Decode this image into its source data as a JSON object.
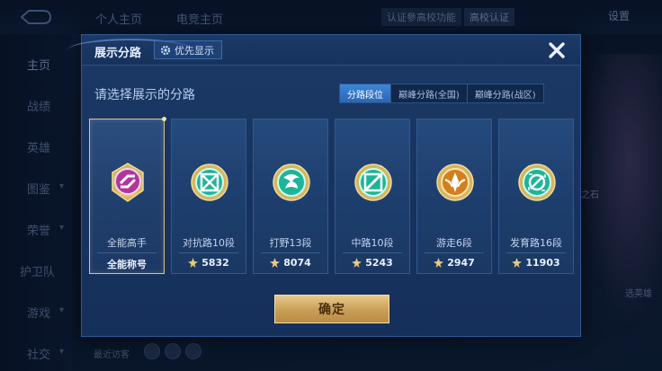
{
  "background": {
    "tabs": [
      "个人主页",
      "电竞主页"
    ],
    "badges": [
      "认证參高校功能",
      "高校认证"
    ],
    "settings_label": "设置",
    "sidebar": [
      "主页",
      "战绩",
      "英雄",
      "图鉴",
      "荣誉",
      "护卫队",
      "游戏",
      "社交"
    ],
    "hero_text": "之石",
    "right_button": "选英雄",
    "recent_label": "最近访客"
  },
  "modal": {
    "title": "展示分路",
    "priority_label": "优先显示",
    "subtitle": "请选择展示的分路",
    "tabs": [
      {
        "label": "分路段位",
        "active": true
      },
      {
        "label": "巅峰分路(全国)",
        "active": false
      },
      {
        "label": "巅峰分路(战区)",
        "active": false
      }
    ],
    "cards": [
      {
        "name": "全能高手",
        "stat": "全能称号",
        "icon": "all-round-emblem-icon",
        "selected": true,
        "show_stat_icon": false
      },
      {
        "name": "对抗路10段",
        "stat": "5832",
        "icon": "clash-lane-emblem-icon",
        "selected": false,
        "show_stat_icon": true
      },
      {
        "name": "打野13段",
        "stat": "8074",
        "icon": "jungle-emblem-icon",
        "selected": false,
        "show_stat_icon": true
      },
      {
        "name": "中路10段",
        "stat": "5243",
        "icon": "mid-lane-emblem-icon",
        "selected": false,
        "show_stat_icon": true
      },
      {
        "name": "游走6段",
        "stat": "2947",
        "icon": "roam-emblem-icon",
        "selected": false,
        "show_stat_icon": true
      },
      {
        "name": "发育路16段",
        "stat": "11903",
        "icon": "farm-lane-emblem-icon",
        "selected": false,
        "show_stat_icon": true
      }
    ],
    "confirm_label": "确定"
  },
  "colors": {
    "selected_border": "#d8c48a",
    "active_tab": "#3d86d8",
    "confirm_gold": "#c89e56",
    "emblem_teal": "#1fb39a",
    "emblem_purple": "#b0369e",
    "emblem_orange": "#d1801f"
  }
}
